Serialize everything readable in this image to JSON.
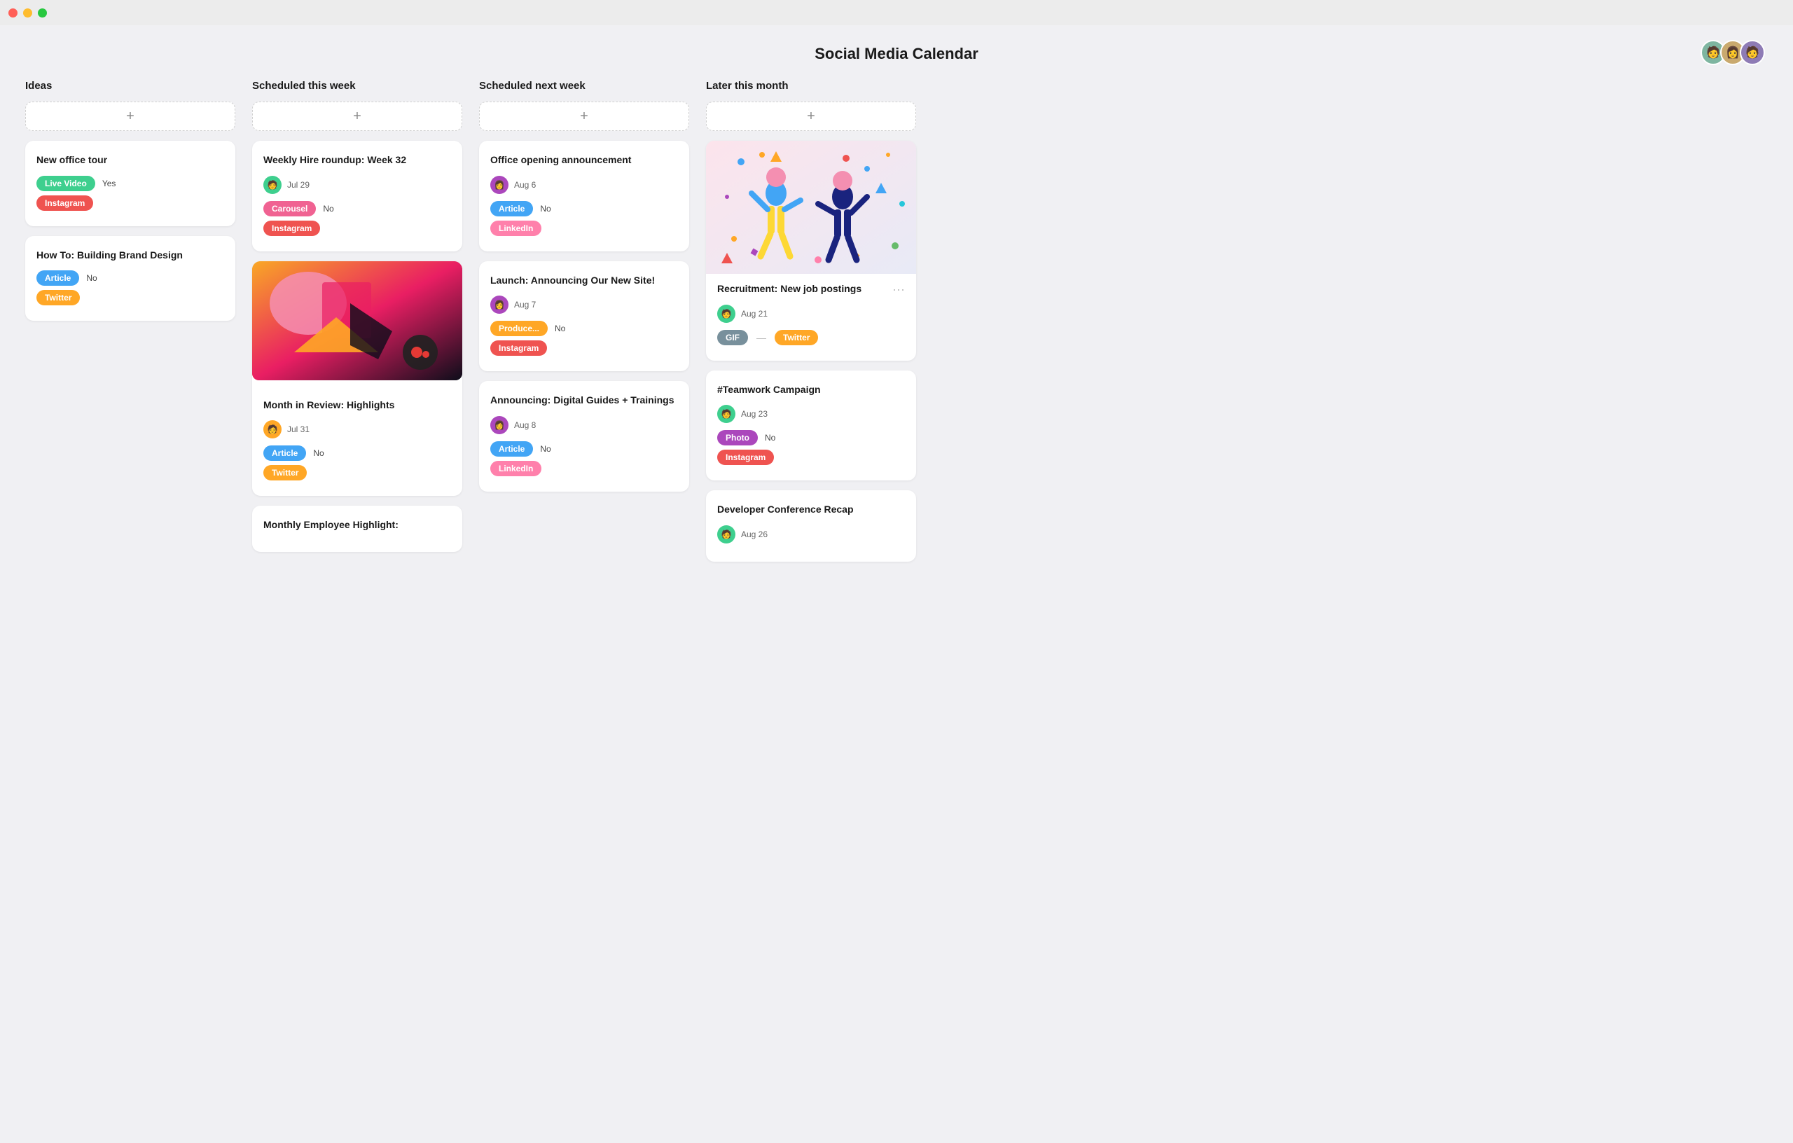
{
  "app": {
    "title": "Social Media Calendar"
  },
  "header_avatars": [
    {
      "color": "#7eb5a0",
      "emoji": "🧑"
    },
    {
      "color": "#c9a96e",
      "emoji": "👩"
    },
    {
      "color": "#8e7bb5",
      "emoji": "🧑"
    }
  ],
  "columns": [
    {
      "id": "ideas",
      "label": "Ideas",
      "add_label": "+",
      "cards": [
        {
          "id": "new-office-tour",
          "title": "New office tour",
          "tag": "Live Video",
          "tag_color": "tag-green",
          "status": "Yes",
          "second_tag": "Instagram",
          "second_tag_color": "tag-red"
        },
        {
          "id": "building-brand-design",
          "title": "How To: Building Brand Design",
          "tag": "Article",
          "tag_color": "tag-blue",
          "status": "No",
          "second_tag": "Twitter",
          "second_tag_color": "tag-orange"
        }
      ]
    },
    {
      "id": "scheduled-this-week",
      "label": "Scheduled this week",
      "add_label": "+",
      "cards": [
        {
          "id": "weekly-hire-roundup",
          "title": "Weekly Hire roundup: Week 32",
          "avatar_color": "#3ecf8e",
          "date": "Jul 29",
          "tag": "Carousel",
          "tag_color": "tag-pink",
          "status": "No",
          "second_tag": "Instagram",
          "second_tag_color": "tag-red"
        },
        {
          "id": "month-in-review",
          "title": "Month in Review: Highlights",
          "has_image": true,
          "image_type": "abstract",
          "avatar_color": "#ffa726",
          "date": "Jul 31",
          "tag": "Article",
          "tag_color": "tag-blue",
          "status": "No",
          "second_tag": "Twitter",
          "second_tag_color": "tag-orange"
        },
        {
          "id": "monthly-employee-highlight",
          "title": "Monthly Employee Highlight:",
          "has_image": false,
          "avatar_color": null,
          "date": null
        }
      ]
    },
    {
      "id": "scheduled-next-week",
      "label": "Scheduled next week",
      "add_label": "+",
      "cards": [
        {
          "id": "office-opening-announcement",
          "title": "Office opening announcement",
          "avatar_color": "#ab47bc",
          "date": "Aug 6",
          "tag": "Article",
          "tag_color": "tag-blue",
          "status": "No",
          "second_tag": "LinkedIn",
          "second_tag_color": "tag-linkedin"
        },
        {
          "id": "launch-new-site",
          "title": "Launch: Announcing Our New Site!",
          "avatar_color": "#ab47bc",
          "date": "Aug 7",
          "tag": "Produce...",
          "tag_color": "tag-produce",
          "status": "No",
          "second_tag": "Instagram",
          "second_tag_color": "tag-red"
        },
        {
          "id": "digital-guides-trainings",
          "title": "Announcing: Digital Guides + Trainings",
          "avatar_color": "#ab47bc",
          "date": "Aug 8",
          "tag": "Article",
          "tag_color": "tag-blue",
          "status": "No",
          "second_tag": "LinkedIn",
          "second_tag_color": "tag-linkedin"
        }
      ]
    },
    {
      "id": "later-this-month",
      "label": "Later this month",
      "add_label": "+",
      "cards": [
        {
          "id": "recruitment-new-job",
          "title": "Recruitment: New job postings",
          "has_celebration_art": true,
          "avatar_color": "#3ecf8e",
          "date": "Aug 21",
          "tag": "GIF",
          "tag_color": "tag-gif",
          "status": null,
          "second_tag": "Twitter",
          "second_tag_color": "tag-orange"
        },
        {
          "id": "teamwork-campaign",
          "title": "#Teamwork Campaign",
          "avatar_color": "#3ecf8e",
          "date": "Aug 23",
          "tag": "Photo",
          "tag_color": "tag-purple",
          "status": "No",
          "second_tag": "Instagram",
          "second_tag_color": "tag-red"
        },
        {
          "id": "developer-conference-recap",
          "title": "Developer Conference Recap",
          "avatar_color": "#3ecf8e",
          "date": "Aug 26"
        }
      ]
    }
  ]
}
